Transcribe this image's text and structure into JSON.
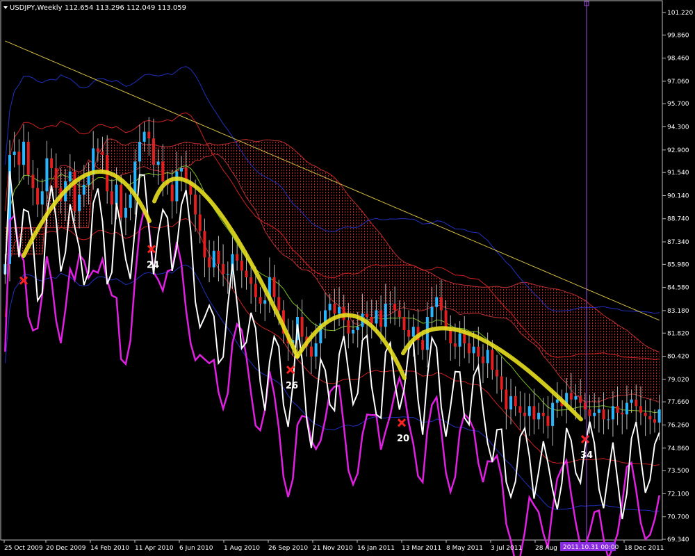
{
  "header": {
    "symbol": "USDJPY,Weekly",
    "ohlc": "112.654 113.296 112.049 113.059"
  },
  "chart_data": {
    "type": "candlestick",
    "title": "USDJPY,Weekly",
    "xlabel": "",
    "ylabel": "",
    "ylim": [
      69.34,
      102.0
    ],
    "y_ticks": [
      "101.220",
      "99.860",
      "98.460",
      "97.060",
      "95.700",
      "94.300",
      "92.900",
      "91.540",
      "90.140",
      "88.740",
      "87.340",
      "85.980",
      "84.580",
      "83.180",
      "81.820",
      "80.420",
      "79.020",
      "77.660",
      "76.260",
      "74.860",
      "73.500",
      "72.100",
      "70.700",
      "69.340"
    ],
    "x_ticks": [
      "25 Oct 2009",
      "20 Dec 2009",
      "14 Feb 2010",
      "11 Apr 2010",
      "6 Jun 2010",
      "1 Aug 2010",
      "26 Sep 2010",
      "21 Nov 2010",
      "16 Jan 2011",
      "13 Mar 2011",
      "8 May 2011",
      "3 Jul 2011",
      "28 Aug",
      "18 Dec 2011"
    ],
    "cursor_label": "2011.10.31 00:00",
    "cycle_lows": [
      {
        "date": "25 Oct 2009",
        "price": 85.0,
        "label": ""
      },
      {
        "date": "11 Apr 2010",
        "price": 86.9,
        "label": "24"
      },
      {
        "date": "26 Sep 2010",
        "price": 79.6,
        "label": "26"
      },
      {
        "date": "13 Mar 2011",
        "price": 76.4,
        "label": "20"
      },
      {
        "date": "31 Oct 2011",
        "price": 75.4,
        "label": "34"
      }
    ],
    "close_approx": [
      86.0,
      92.6,
      92.8,
      92.0,
      93.4,
      91.4,
      90.6,
      89.6,
      90.4,
      92.4,
      91.8,
      90.6,
      89.8,
      91.0,
      91.6,
      89.2,
      90.2,
      90.8,
      91.4,
      93.0,
      92.8,
      92.6,
      90.4,
      89.6,
      90.8,
      88.8,
      89.4,
      90.2,
      92.2,
      93.4,
      94.0,
      93.6,
      92.0,
      92.2,
      91.0,
      90.8,
      89.8,
      91.6,
      91.8,
      91.0,
      90.2,
      89.0,
      88.0,
      86.4,
      85.8,
      86.8,
      86.0,
      85.4,
      85.4,
      86.6,
      86.2,
      85.6,
      85.2,
      84.8,
      84.0,
      83.6,
      83.8,
      85.2,
      84.0,
      83.2,
      81.8,
      81.2,
      81.4,
      82.8,
      81.6,
      81.0,
      80.4,
      81.2,
      82.4,
      83.2,
      83.6,
      83.0,
      83.4,
      82.6,
      81.8,
      82.0,
      82.2,
      83.0,
      82.8,
      82.4,
      83.2,
      82.2,
      83.6,
      83.6,
      83.2,
      82.8,
      82.0,
      81.6,
      82.2,
      81.4,
      80.8,
      82.8,
      83.4,
      84.0,
      83.2,
      82.0,
      81.2,
      81.0,
      81.8,
      81.2,
      80.6,
      81.0,
      80.4,
      80.0,
      80.8,
      79.6,
      79.2,
      78.4,
      77.2,
      78.0,
      77.4,
      77.0,
      76.8,
      77.4,
      76.6,
      77.0,
      76.8,
      76.2,
      77.6,
      77.8,
      77.4,
      78.2,
      77.8,
      78.0,
      77.6,
      77.2,
      76.8,
      77.0,
      77.2,
      76.6,
      76.6,
      77.4,
      77.0,
      76.9,
      77.6,
      77.8,
      77.4,
      77.0,
      76.8,
      76.6,
      76.4,
      77.2
    ]
  }
}
